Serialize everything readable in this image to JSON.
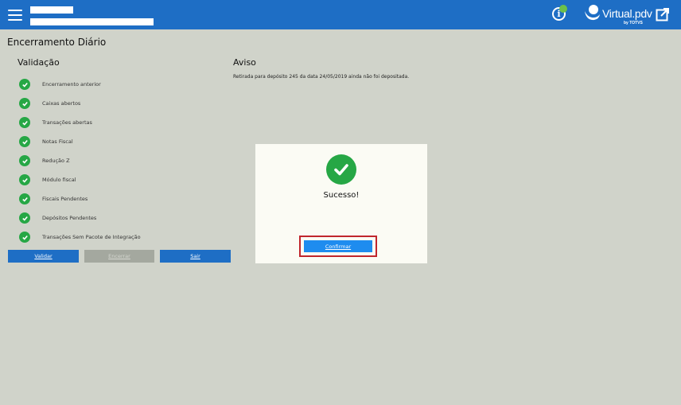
{
  "header": {
    "logo_text": "Virtual.pdv",
    "logo_subtext": "by TOTVS",
    "icons": {
      "menu": "hamburger-icon",
      "info": "info-icon",
      "logo": "virtualpdv-logo-icon",
      "exit": "exit-window-icon"
    },
    "colors": {
      "bar": "#1e6ec5",
      "status_dot": "#6cc04a"
    }
  },
  "page": {
    "title": "Encerramento Diário"
  },
  "validacao": {
    "heading": "Validação",
    "items": [
      {
        "label": "Encerramento anterior",
        "status": "check-circle-icon"
      },
      {
        "label": "Caixas abertos",
        "status": "check-circle-icon"
      },
      {
        "label": "Transações abertas",
        "status": "check-circle-icon"
      },
      {
        "label": "Notas Fiscal",
        "status": "check-circle-icon"
      },
      {
        "label": "Redução Z",
        "status": "check-circle-icon"
      },
      {
        "label": "Módulo fiscal",
        "status": "check-circle-icon"
      },
      {
        "label": "Fiscais Pendentes",
        "status": "check-circle-icon"
      },
      {
        "label": "Depósitos Pendentes",
        "status": "check-circle-icon"
      },
      {
        "label": "Transações Sem Pacote de Integração",
        "status": "check-circle-icon"
      }
    ]
  },
  "aviso": {
    "heading": "Aviso",
    "message": "Retirada para depósito 245 da data 24/05/2019 ainda não foi depositada."
  },
  "actions": {
    "validar": "Validar",
    "encerrar": "Encerrar",
    "sair": "Sair"
  },
  "modal": {
    "icon": "success-check-icon",
    "message": "Sucesso!",
    "confirm_label": "Confirmar",
    "colors": {
      "success": "#26a745",
      "confirm": "#1e8cef",
      "highlight": "#c0262d"
    }
  }
}
